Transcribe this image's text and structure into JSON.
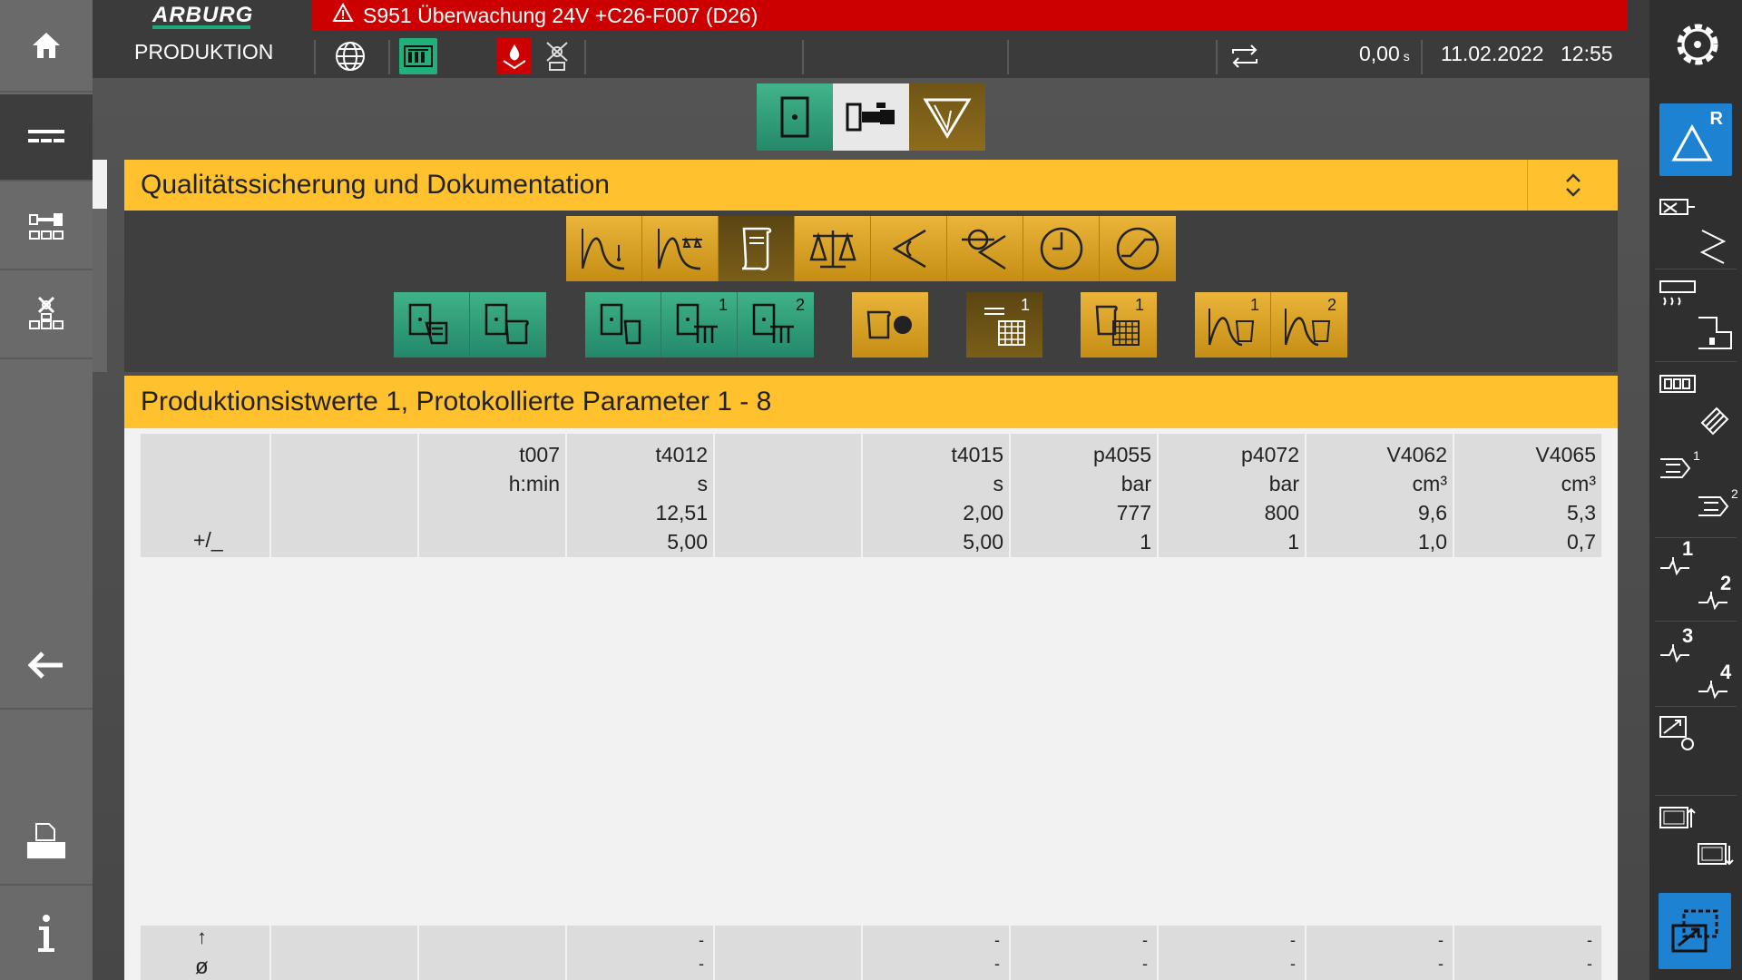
{
  "brand": {
    "logo": "ARBURG",
    "mode": "PRODUKTION"
  },
  "alarm": {
    "icon": "warning-triangle-icon",
    "text": "S951 Überwachung 24V +C26-F007 (D26)"
  },
  "status": {
    "cycle_value": "0,00",
    "cycle_unit": "s",
    "date": "11.02.2022",
    "time": "12:55"
  },
  "colors": {
    "accent_yellow": "#ffc12e",
    "accent_green": "#2ea37a",
    "alarm_red": "#cc0000",
    "blue": "#1e82d2"
  },
  "section1": {
    "title": "Qualitätssicherung und Dokumentation"
  },
  "section2": {
    "title": "Produktionsistwerte 1, Protokollierte Parameter 1 - 8"
  },
  "table": {
    "tolerance_label": "+/_",
    "columns": [
      {
        "name": "",
        "unit": "",
        "nominal": "",
        "tolerance": ""
      },
      {
        "name": "",
        "unit": "",
        "nominal": "",
        "tolerance": ""
      },
      {
        "name": "t007",
        "unit": "h:min",
        "nominal": "",
        "tolerance": ""
      },
      {
        "name": "t4012",
        "unit": "s",
        "nominal": "12,51",
        "tolerance": "5,00"
      },
      {
        "name": "",
        "unit": "",
        "nominal": "",
        "tolerance": ""
      },
      {
        "name": "t4015",
        "unit": "s",
        "nominal": "2,00",
        "tolerance": "5,00"
      },
      {
        "name": "p4055",
        "unit": "bar",
        "nominal": "777",
        "tolerance": "1"
      },
      {
        "name": "p4072",
        "unit": "bar",
        "nominal": "800",
        "tolerance": "1"
      },
      {
        "name": "V4062",
        "unit": "cm³",
        "nominal": "9,6",
        "tolerance": "1,0"
      },
      {
        "name": "V4065",
        "unit": "cm³",
        "nominal": "5,3",
        "tolerance": "0,7"
      }
    ],
    "footer_label_arrow": "↑",
    "footer_label": "ø",
    "footer_values": [
      "",
      "",
      "-",
      "-",
      "-",
      "-",
      "-",
      "-",
      "-",
      "-"
    ]
  },
  "page_buttons": {
    "top1_label": "1",
    "top2_label": "2",
    "grid1_label": "1",
    "grid2_label": "1",
    "curve1_label": "1",
    "curve2_label": "2"
  },
  "right_labels": {
    "r1": "R",
    "s1": "1",
    "s2": "2",
    "p1": "1",
    "p2": "2",
    "p3": "3",
    "p4": "4"
  }
}
